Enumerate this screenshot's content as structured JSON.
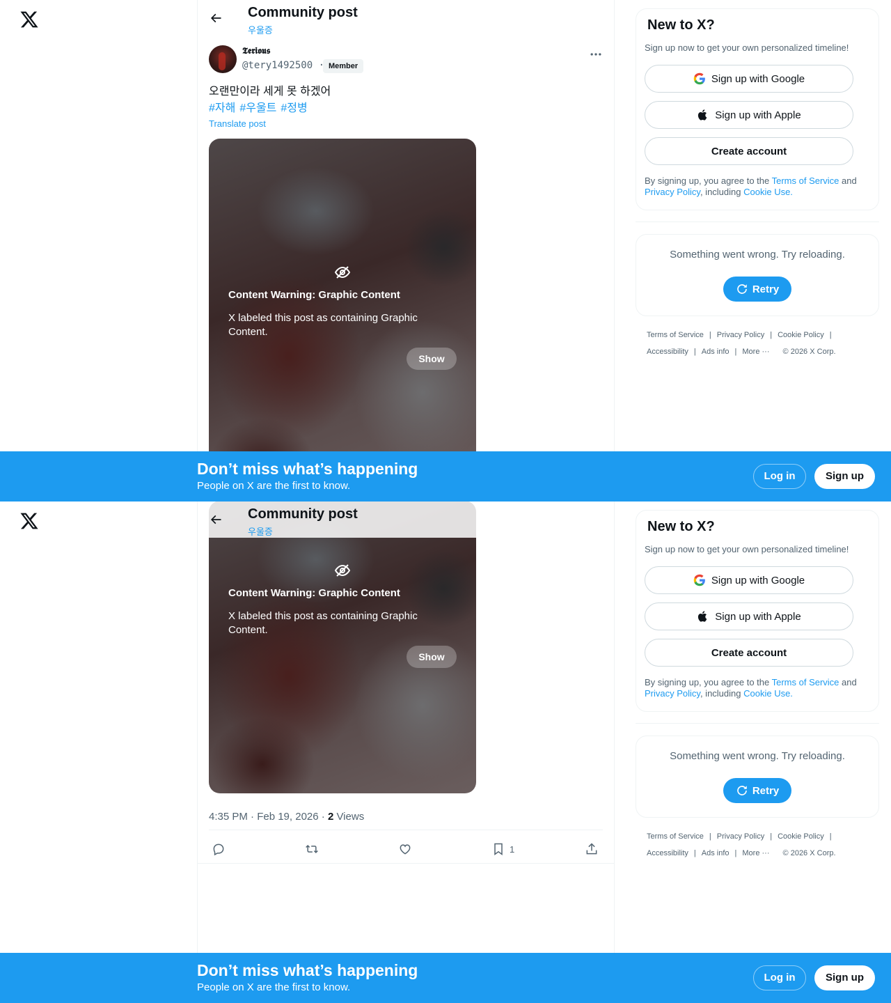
{
  "header": {
    "title": "Community post",
    "community": "우울증"
  },
  "post": {
    "author_name": "𝕿𝖊𝖗𝖎𝖔𝖚𝖘",
    "author_handle": "@tery1492500 ·",
    "badge": "Member",
    "text": "오랜만이라 세게 못 하겠어",
    "hashtags": [
      "#자해",
      "#우울트",
      "#정병"
    ],
    "translate": "Translate post",
    "content_warning": {
      "title": "Content Warning: Graphic Content",
      "description": "X labeled this post as containing Graphic Content.",
      "show_label": "Show"
    },
    "timestamp": "4:35 PM · Feb 19, 2026 · ",
    "views_count": "2",
    "views_label": " Views",
    "bookmarks_count": "1"
  },
  "signup_card": {
    "title": "New to X?",
    "subtitle": "Sign up now to get your own personalized timeline!",
    "google": "Sign up with Google",
    "apple": "Sign up with Apple",
    "create": "Create account",
    "legal_1": "By signing up, you agree to the ",
    "terms": "Terms of Service",
    "legal_2": " and ",
    "privacy": "Privacy Policy",
    "legal_3": ", including ",
    "cookie": "Cookie Use."
  },
  "error_card": {
    "message": "Something went wrong. Try reloading.",
    "retry": "Retry"
  },
  "footer": {
    "terms": "Terms of Service",
    "privacy": "Privacy Policy",
    "cookie": "Cookie Policy",
    "accessibility": "Accessibility",
    "ads": "Ads info",
    "more": "More ···",
    "copyright": "© 2026 X Corp."
  },
  "banner": {
    "title": "Don’t miss what’s happening",
    "subtitle": "People on X are the first to know.",
    "login": "Log in",
    "signup": "Sign up"
  },
  "colors": {
    "accent": "#1d9bf0",
    "text": "#0f1419",
    "muted": "#536471"
  }
}
